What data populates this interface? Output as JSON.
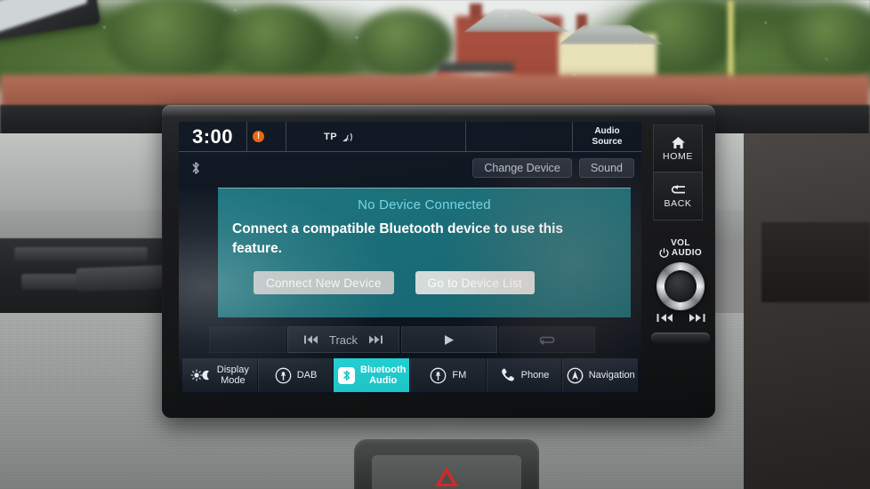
{
  "device": {
    "type": "car-infotainment-head-unit",
    "brand_context": "honda-style"
  },
  "status_bar": {
    "clock": "3:00",
    "alert_badge": "!",
    "alert_badge_color": "#e8690f",
    "tp_label": "TP",
    "tp_icon": "broadcast-signal-icon",
    "audio_source_line1": "Audio",
    "audio_source_line2": "Source",
    "bluetooth_icon": "bluetooth-icon"
  },
  "sub_bar": {
    "change_device_label": "Change Device",
    "sound_label": "Sound"
  },
  "dialog": {
    "title": "No Device Connected",
    "title_color": "#73d6e6",
    "body": "Connect a compatible Bluetooth device to use this feature.",
    "background_color": "#1b6f79",
    "buttons": [
      {
        "label": "Connect New Device",
        "style": "secondary"
      },
      {
        "label": "Go to Device List",
        "style": "primary"
      }
    ]
  },
  "media_controls": {
    "prev_icon": "previous-track-icon",
    "track_label": "Track",
    "next_icon": "next-track-icon",
    "play_icon": "play-icon",
    "repeat_icon": "repeat-icon"
  },
  "bottom_nav": {
    "items": [
      {
        "label_line1": "Display",
        "label_line2": "Mode",
        "icon": "sun-moon-icon",
        "active": false
      },
      {
        "label_line1": "DAB",
        "label_line2": "",
        "icon": "radio-antenna-icon",
        "active": false
      },
      {
        "label_line1": "Bluetooth",
        "label_line2": "Audio",
        "icon": "bluetooth-icon",
        "active": true
      },
      {
        "label_line1": "FM",
        "label_line2": "",
        "icon": "radio-antenna-icon",
        "active": false
      },
      {
        "label_line1": "Phone",
        "label_line2": "",
        "icon": "phone-handset-icon",
        "active": false
      },
      {
        "label_line1": "Navigation",
        "label_line2": "",
        "icon": "compass-icon",
        "active": false
      }
    ],
    "active_color": "#1ec3c7"
  },
  "hardware_buttons": {
    "home_label": "HOME",
    "home_icon": "home-icon",
    "back_label": "BACK",
    "back_icon": "back-arrow-icon",
    "volume_label_line1": "VOL",
    "volume_label_line2": "AUDIO",
    "power_icon": "power-icon",
    "knob": "volume-knob",
    "skip_prev_icon": "previous-track-icon",
    "skip_next_icon": "next-track-icon"
  },
  "dashboard": {
    "hazard_button_icon": "hazard-triangle-icon",
    "hazard_color": "#cf2b2b"
  }
}
